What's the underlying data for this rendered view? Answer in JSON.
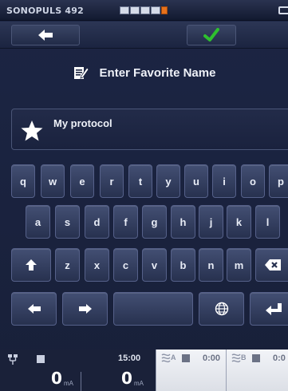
{
  "status": {
    "device": "SONOPULS 492"
  },
  "nav": {
    "back": "back-arrow-icon",
    "confirm": "checkmark-icon",
    "confirm_color": "#2ec02e"
  },
  "dialog": {
    "title": "Enter Favorite Name",
    "title_icon": "edit-note-icon"
  },
  "field": {
    "icon": "star-icon",
    "value": "My protocol"
  },
  "keyboard": {
    "row1": [
      "q",
      "w",
      "e",
      "r",
      "t",
      "y",
      "u",
      "i",
      "o",
      "p"
    ],
    "row2": [
      "a",
      "s",
      "d",
      "f",
      "g",
      "h",
      "j",
      "k",
      "l"
    ],
    "row3": [
      "shift-icon",
      "z",
      "x",
      "c",
      "v",
      "b",
      "n",
      "m",
      "backspace-icon"
    ],
    "row4": [
      "cursor-left-icon",
      "cursor-right-icon",
      "space",
      "globe-icon",
      "enter-icon"
    ]
  },
  "panel": {
    "total_time": "15:00",
    "channel_left_value": "0",
    "channel_left_unit": "mA",
    "channel_right_value": "0",
    "channel_right_unit": "mA",
    "channel_a": {
      "letter": "A",
      "time": "0:00"
    },
    "channel_b": {
      "letter": "B",
      "time": "0:0"
    }
  }
}
